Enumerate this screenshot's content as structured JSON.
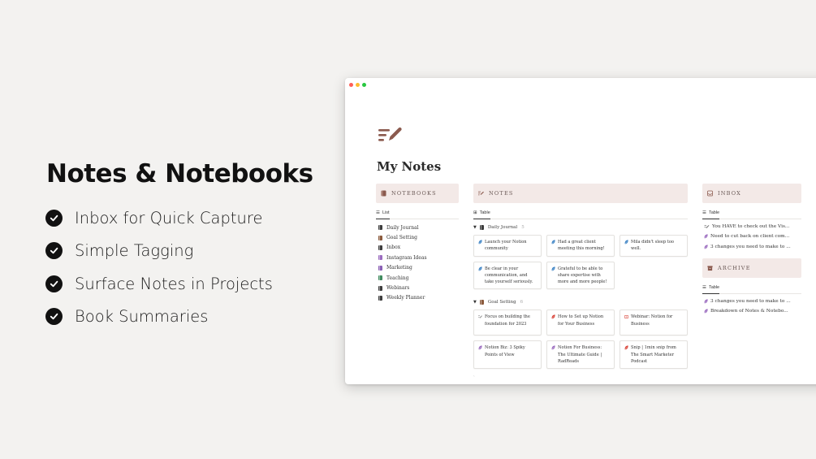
{
  "hero": {
    "title": "Notes & Notebooks",
    "features": [
      "Inbox for Quick Capture",
      "Simple Tagging",
      "Surface Notes in Projects",
      "Book Summaries"
    ]
  },
  "page": {
    "title": "My Notes",
    "icon": "notes-pencil-icon"
  },
  "notebooks": {
    "header": "NOTEBOOKS",
    "view": "List",
    "items": [
      {
        "label": "Daily Journal",
        "color": "#3d3d3d"
      },
      {
        "label": "Goal Setting",
        "color": "#8b5a3c"
      },
      {
        "label": "Inbox",
        "color": "#3d3d3d"
      },
      {
        "label": "Instagram Ideas",
        "color": "#9a6bbf"
      },
      {
        "label": "Marketing",
        "color": "#8a5fb5"
      },
      {
        "label": "Teaching",
        "color": "#3f8a5e"
      },
      {
        "label": "Webinars",
        "color": "#3d3d3d"
      },
      {
        "label": "Weekly Planner",
        "color": "#3d3d3d"
      }
    ]
  },
  "notes": {
    "header": "NOTES",
    "view": "Table",
    "groups": [
      {
        "name": "Daily Journal",
        "count": "5",
        "cards": [
          {
            "text": "Launch your Notion community",
            "icon_color": "#3b82c4"
          },
          {
            "text": "Had a great client meeting this morning!",
            "icon_color": "#3b82c4"
          },
          {
            "text": "Mila didn't sleep too well.",
            "icon_color": "#3b82c4"
          },
          {
            "text": "Be clear in your communication, and take yourself seriously.",
            "icon_color": "#3b82c4"
          },
          {
            "text": "Grateful to be able to share expertise with more and more people!",
            "icon_color": "#3b82c4"
          }
        ]
      },
      {
        "name": "Goal Setting",
        "count": "6",
        "cards": [
          {
            "text": "Focus on building the foundation for 2023",
            "icon_color": "#888888"
          },
          {
            "text": "How to Set up Notion for Your Business",
            "icon_color": "#d9453a"
          },
          {
            "text": "Webinar: Notion for Business",
            "icon_color": "#d9453a"
          },
          {
            "text": "Notion Biz: 3 Spiky Points of View",
            "icon_color": "#9a6bbf"
          },
          {
            "text": "Notion For Business: The Ultimate Guide | RadReads",
            "icon_color": "#9a6bbf"
          },
          {
            "text": "Snip | 1min snip from The Smart Marketer Podcast",
            "icon_color": "#d9453a"
          }
        ]
      }
    ],
    "more": "ˎ"
  },
  "inbox": {
    "header": "INBOX",
    "view": "Table",
    "rows": [
      {
        "text": "You HAVE to check out the Vis...",
        "icon_color": "#888888"
      },
      {
        "text": "Need to cut back on client com...",
        "icon_color": "#9a6bbf"
      },
      {
        "text": "3 changes you need to make to ...",
        "icon_color": "#9a6bbf"
      }
    ]
  },
  "archive": {
    "header": "ARCHIVE",
    "view": "Table",
    "rows": [
      {
        "text": "3 changes you need to make to ...",
        "icon_color": "#9a6bbf"
      },
      {
        "text": "Breakdown of Notes & Notebo...",
        "icon_color": "#9a6bbf"
      }
    ]
  },
  "colors": {
    "header_bg": "#f3e9e7",
    "accent": "#8b5a4e",
    "background": "#f3f2f0"
  }
}
